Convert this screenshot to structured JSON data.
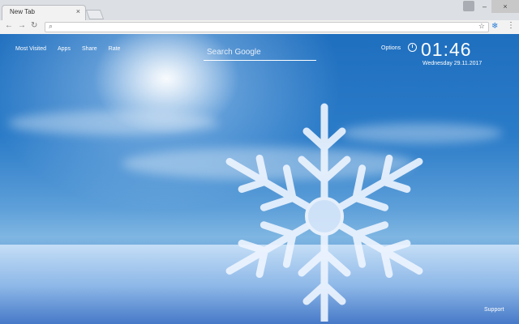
{
  "tab": {
    "title": "New Tab",
    "close": "×"
  },
  "window": {
    "minimize": "–",
    "maximize": "□",
    "close": "×"
  },
  "toolbar": {
    "back": "←",
    "forward": "→",
    "reload": "↻",
    "address_value": "",
    "search_icon": "🔍",
    "star": "☆",
    "ext": "❄",
    "menu": "⋮"
  },
  "nav": {
    "most_visited": "Most Visited",
    "apps": "Apps",
    "share": "Share",
    "rate": "Rate"
  },
  "search": {
    "placeholder": "Search Google"
  },
  "options": "Options",
  "clock": {
    "time": "01:46",
    "date": "Wednesday  29.11.2017"
  },
  "support": "Support",
  "colors": {
    "sky": "#2a7bc8",
    "snow": "#d2e6fa",
    "chrome": "#dcdfe3"
  }
}
